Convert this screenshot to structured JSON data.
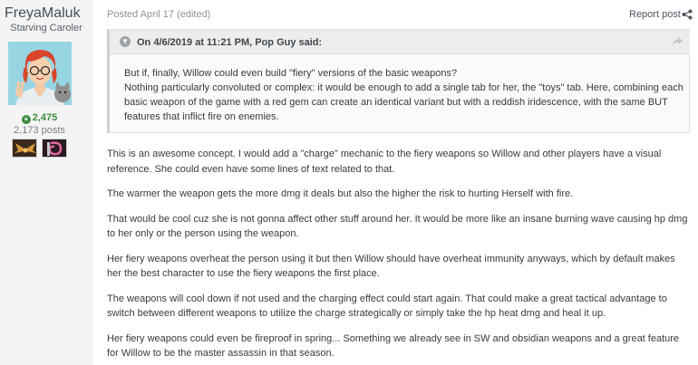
{
  "author": {
    "username": "FreyaMaluk",
    "rank": "Starving Caroler",
    "reputation": "2,475",
    "post_count": "2,173 posts",
    "badges": [
      "wings-badge",
      "pink-swirl-badge"
    ]
  },
  "post": {
    "meta": "Posted April 17 (edited)",
    "report_label": "Report post"
  },
  "quote": {
    "citation": "On 4/6/2019 at 11:21 PM, Pop Guy said:",
    "lines": [
      "But if, finally, Willow could even build \"fiery\" versions of the basic weapons?",
      "Nothing particularly convoluted or complex: it would be enough to add a single tab for her, the \"toys\" tab. Here, combining each basic weapon of the game with a red gem can create an identical variant but with a reddish iridescence, with the same BUT features that inflict fire on enemies."
    ]
  },
  "body": {
    "paragraphs": [
      "This is an awesome concept. I would add a \"charge\" mechanic to the fiery weapons so Willow and other players have a visual reference. She could even have some lines of text related to that.",
      "The warmer the weapon gets the more dmg it deals but also the higher the risk to hurting Herself with fire.",
      "That would be cool cuz she is not gonna affect other stuff around her. It would be more like an insane burning wave causing hp dmg to her only or the person using the weapon.",
      "Her fiery weapons overheat the person using it but then Willow should have overheat immunity anyways, which by default makes her the best character to use the fiery weapons the first place.",
      "The weapons will cool down if not used and the charging effect could start again. That could make a great tactical advantage to switch between different weapons to utilize the charge strategically or simply take the hp heat dmg and heal it up.",
      "Her fiery weapons could even be fireproof in spring... Something we already see in SW and obsidian weapons and a great feature for Willow to be the master assassin in that season."
    ]
  },
  "icons": {
    "reputation": "plus-circle-icon",
    "share": "share-icon",
    "quote_toggle": "chevron-down-circle-icon",
    "quote_jump": "share-arrow-icon"
  },
  "colors": {
    "reputation_green": "#3e8b3e",
    "sidebar_bg": "#f4f4f4",
    "quote_header_bg": "#ededed"
  }
}
